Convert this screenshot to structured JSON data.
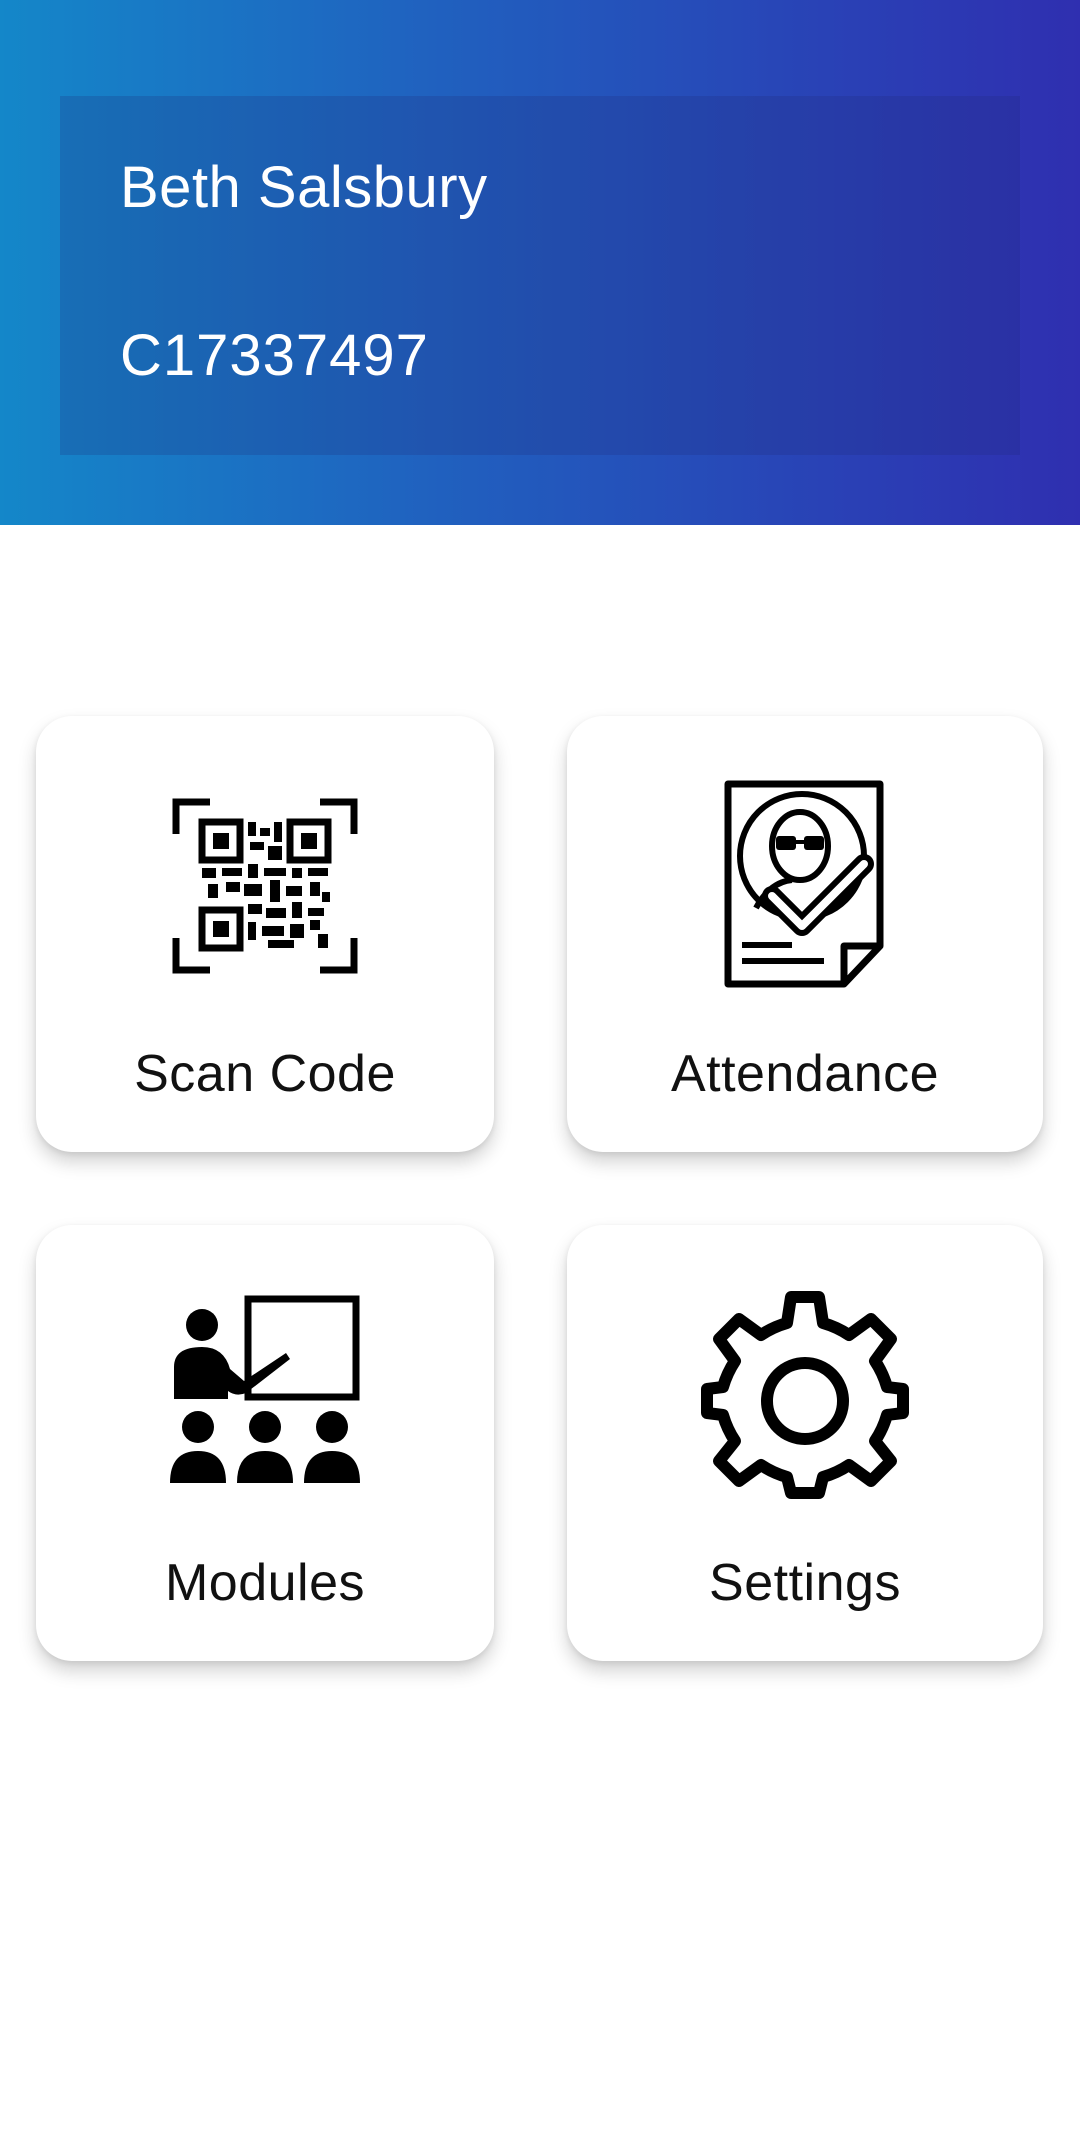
{
  "profile": {
    "name": "Beth Salsbury",
    "student_id": "C17337497"
  },
  "menu": [
    {
      "label": "Scan Code",
      "icon": "qr-code-icon"
    },
    {
      "label": "Attendance",
      "icon": "attendance-icon"
    },
    {
      "label": "Modules",
      "icon": "classroom-icon"
    },
    {
      "label": "Settings",
      "icon": "gear-icon"
    }
  ],
  "colors": {
    "header_gradient_start": "#1487c9",
    "header_gradient_end": "#2f2fb0",
    "card_background": "#ffffff",
    "text_dark": "#111111"
  }
}
